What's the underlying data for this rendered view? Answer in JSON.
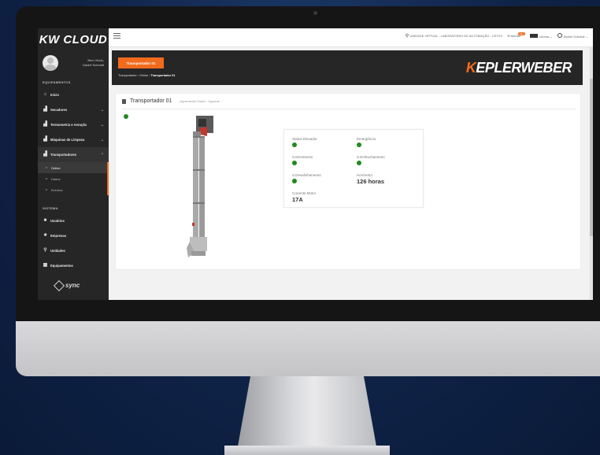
{
  "sidebar": {
    "brand": "KW CLOUD",
    "greeting": "Bem Vindo,",
    "user_name": "Daniel Schmidt",
    "section_equipamentos": "EQUIPAMENTOS",
    "items": [
      {
        "label": "Início",
        "icon": "home-icon"
      },
      {
        "label": "Secadores",
        "icon": "equipment-icon"
      },
      {
        "label": "Termometria e Aeração",
        "icon": "equipment-icon"
      },
      {
        "label": "Máquinas de Limpeza",
        "icon": "equipment-icon"
      },
      {
        "label": "Transportadores",
        "icon": "equipment-icon"
      }
    ],
    "sub_items": [
      "Online",
      "Dados",
      "Eventos"
    ],
    "section_sistema": "SISTEMA",
    "system_items": [
      {
        "label": "Usuários",
        "icon": "users-icon"
      },
      {
        "label": "Empresas",
        "icon": "building-icon"
      },
      {
        "label": "Unidades",
        "icon": "location-pin-icon"
      },
      {
        "label": "Equipamentos",
        "icon": "equipment-list-icon"
      }
    ],
    "footer_logo": "sync"
  },
  "topbar": {
    "unit": "UNIDADE VIRTUAL - LABORATORIO DE AUTOMAÇÃO - CETEX",
    "alerts_label": "Alertas",
    "alerts_badge": "99+",
    "language_label": "Idioma",
    "user_label": "Daniel Schmidt"
  },
  "banner": {
    "button_label": "Transportador 01",
    "breadcrumb": [
      "Transportador",
      "Online",
      "Transportador 01"
    ],
    "logo_k": "K",
    "logo_rest": "EPLERWEBER"
  },
  "card": {
    "title": "Transportador 01",
    "subtitle": "- Aguardando Dados - Aguarde...",
    "fields": [
      {
        "label": "Status Elevador",
        "kind": "dot"
      },
      {
        "label": "Emergência",
        "kind": "dot"
      },
      {
        "label": "S.Movimento",
        "kind": "dot"
      },
      {
        "label": "S.Embuchamento",
        "kind": "dot"
      },
      {
        "label": "S.Desalinhamento",
        "kind": "dot"
      },
      {
        "label": "Horímetro",
        "value": "126 horas"
      },
      {
        "label": "Corrente Motor",
        "value": "17A"
      }
    ]
  },
  "colors": {
    "accent": "#f26b1d",
    "status_ok": "#1e8a1e",
    "sidebar_bg": "#262626"
  }
}
